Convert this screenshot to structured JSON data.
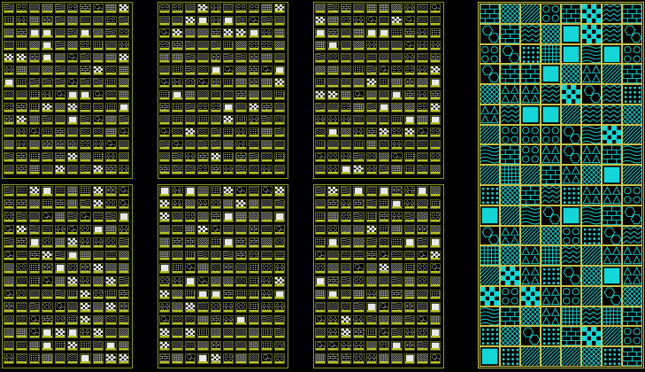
{
  "viewport": {
    "name": "cad-model-space",
    "background": "#000000"
  },
  "colors": {
    "sheet_border": "#8a9a1e",
    "cell_border": "#5a6412",
    "label_bar": "#b7c22a",
    "hatch_white": "#e8e8e8",
    "hatch_cyan": "#14d6d6",
    "cyan_grid": "#c9c24a"
  },
  "pattern_icons": [
    "brick-hatch-icon",
    "diagonal-hatch-icon",
    "cross-hatch-icon",
    "dots-hatch-icon",
    "checker-hatch-icon",
    "wave-hatch-icon",
    "circle-hatch-icon",
    "grid-hatch-icon",
    "zigzag-hatch-icon",
    "triangle-hatch-icon",
    "hexagon-hatch-icon",
    "solid-hatch-icon"
  ],
  "panels": [
    {
      "name": "hatch-sheet-1a",
      "cols": 10,
      "rows": 14,
      "color": "white"
    },
    {
      "name": "hatch-sheet-1b",
      "cols": 10,
      "rows": 14,
      "color": "white"
    },
    {
      "name": "hatch-sheet-2a",
      "cols": 10,
      "rows": 14,
      "color": "white"
    },
    {
      "name": "hatch-sheet-2b",
      "cols": 10,
      "rows": 14,
      "color": "white"
    },
    {
      "name": "hatch-sheet-3a",
      "cols": 10,
      "rows": 14,
      "color": "white"
    },
    {
      "name": "hatch-sheet-3b",
      "cols": 10,
      "rows": 14,
      "color": "white"
    },
    {
      "name": "hatch-sheet-cyan",
      "cols": 8,
      "rows": 18,
      "color": "cyan"
    }
  ]
}
